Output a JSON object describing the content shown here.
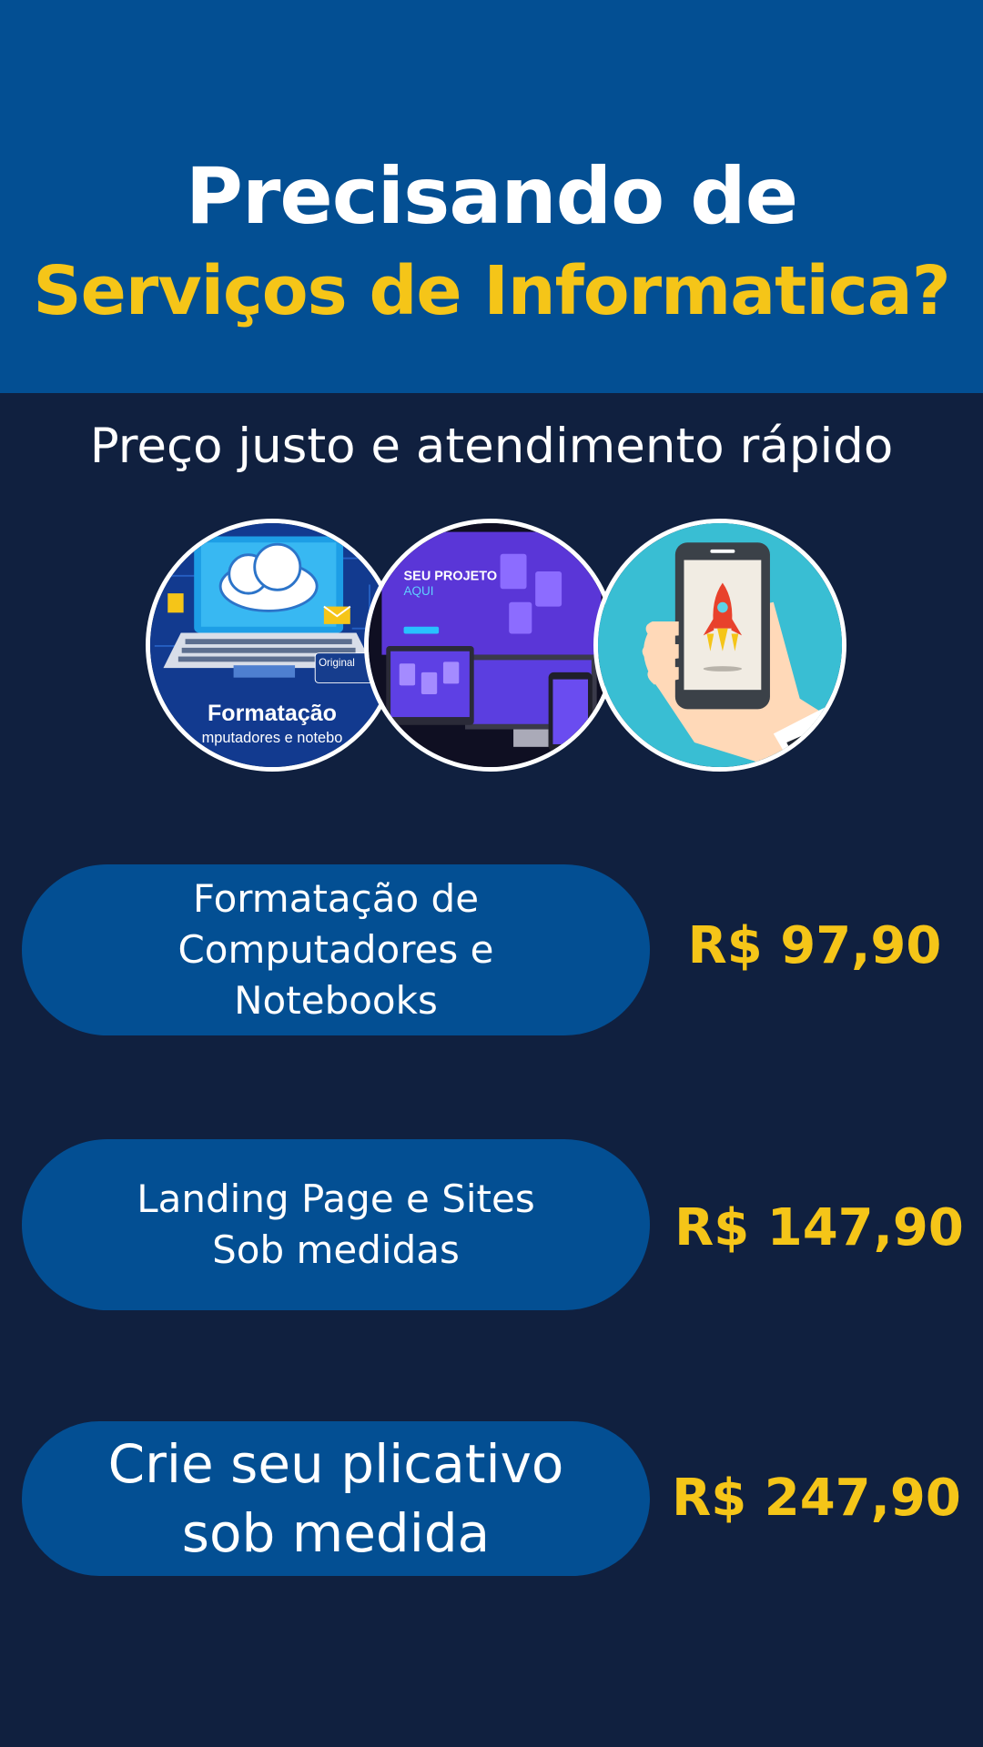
{
  "header": {
    "title_line1": "Precisando de",
    "title_line2": "Serviços de Informatica?"
  },
  "subtitle": "Preço justo e atendimento rápido",
  "images": [
    {
      "icon": "laptop-cloud-icon",
      "caption": "Formatação",
      "caption_sub": "mputadores e notebo",
      "badge": "Original"
    },
    {
      "icon": "website-devices-icon",
      "headline": "SEU PROJETO",
      "headline_sub": "AQUI"
    },
    {
      "icon": "phone-rocket-icon"
    }
  ],
  "services": [
    {
      "label": "Formatação de\nComputadores e\nNotebooks",
      "price": "R$ 97,90"
    },
    {
      "label": "Landing Page e Sites\nSob medidas",
      "price": "R$ 147,90"
    },
    {
      "label": "Crie seu plicativo\nsob medida",
      "price": "R$ 247,90"
    }
  ],
  "colors": {
    "header_bg": "#034f93",
    "page_bg": "#10203f",
    "accent_yellow": "#f5c518",
    "pill_bg": "#034f93"
  }
}
